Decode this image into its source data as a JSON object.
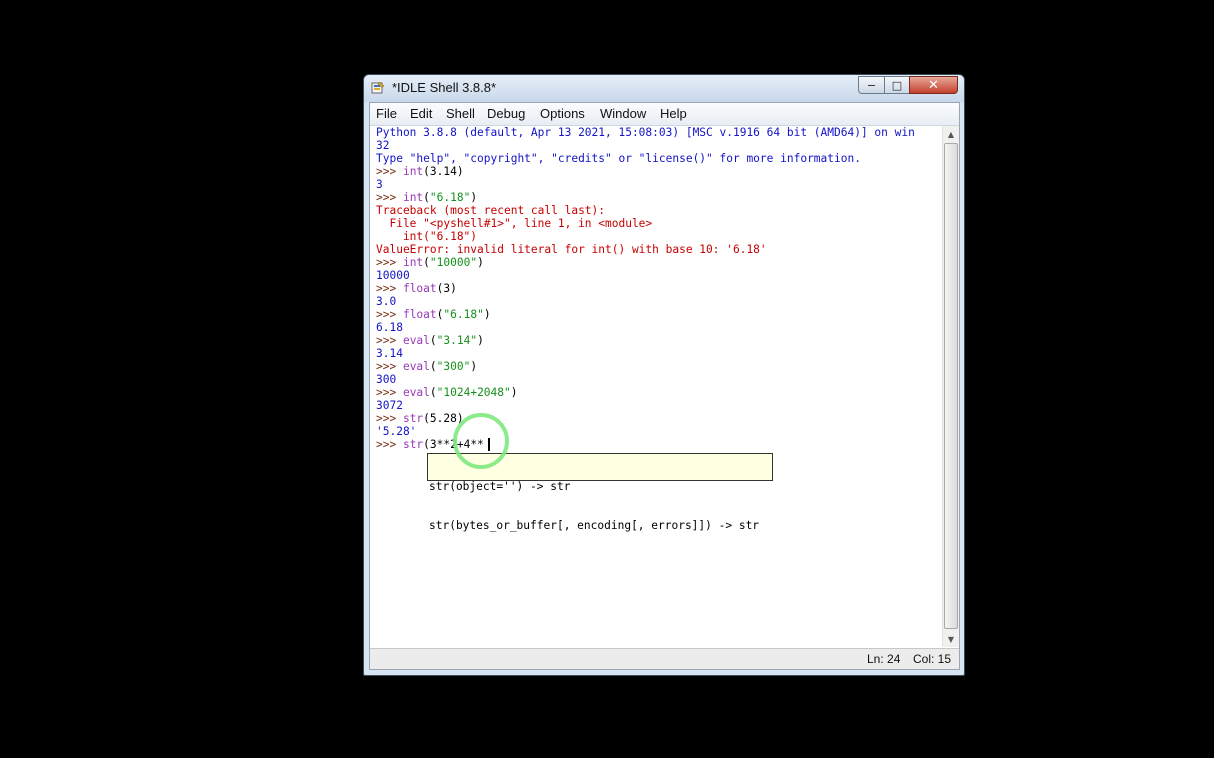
{
  "window": {
    "title": "*IDLE Shell 3.8.8*",
    "controls": {
      "minimize": "−",
      "maximize": "□",
      "close": "✕"
    }
  },
  "menu": [
    "File",
    "Edit",
    "Shell",
    "Debug",
    "Options",
    "Window",
    "Help"
  ],
  "colors": {
    "stdout": "#1313c8",
    "stderr": "#c80000",
    "keyword": "#9a38b8",
    "string": "#14901a",
    "prompt": "#7a2e16",
    "calltip_bg": "#ffffe1"
  },
  "shell_lines": [
    [
      {
        "t": "Python 3.8.8 (default, Apr 13 2021, 15:08:03) [MSC v.1916 64 bit (AMD64)] on win",
        "c": "stdout"
      }
    ],
    [
      {
        "t": "32",
        "c": "stdout"
      }
    ],
    [
      {
        "t": "Type \"help\", \"copyright\", \"credits\" or \"license()\" for more information.",
        "c": "stdout"
      }
    ],
    [
      {
        "t": ">>> ",
        "c": "prompt"
      },
      {
        "t": "int",
        "c": "keyword"
      },
      {
        "t": "(3.14)",
        "c": "plain"
      }
    ],
    [
      {
        "t": "3",
        "c": "stdout"
      }
    ],
    [
      {
        "t": ">>> ",
        "c": "prompt"
      },
      {
        "t": "int",
        "c": "keyword"
      },
      {
        "t": "(",
        "c": "plain"
      },
      {
        "t": "\"6.18\"",
        "c": "string"
      },
      {
        "t": ")",
        "c": "plain"
      }
    ],
    [
      {
        "t": "Traceback (most recent call last):",
        "c": "stderr"
      }
    ],
    [
      {
        "t": "  File \"<pyshell#1>\", line 1, in <module>",
        "c": "stderr"
      }
    ],
    [
      {
        "t": "    int(\"6.18\")",
        "c": "stderr"
      }
    ],
    [
      {
        "t": "ValueError: invalid literal for int() with base 10: '6.18'",
        "c": "stderr"
      }
    ],
    [
      {
        "t": ">>> ",
        "c": "prompt"
      },
      {
        "t": "int",
        "c": "keyword"
      },
      {
        "t": "(",
        "c": "plain"
      },
      {
        "t": "\"10000\"",
        "c": "string"
      },
      {
        "t": ")",
        "c": "plain"
      }
    ],
    [
      {
        "t": "10000",
        "c": "stdout"
      }
    ],
    [
      {
        "t": ">>> ",
        "c": "prompt"
      },
      {
        "t": "float",
        "c": "keyword"
      },
      {
        "t": "(3)",
        "c": "plain"
      }
    ],
    [
      {
        "t": "3.0",
        "c": "stdout"
      }
    ],
    [
      {
        "t": ">>> ",
        "c": "prompt"
      },
      {
        "t": "float",
        "c": "keyword"
      },
      {
        "t": "(",
        "c": "plain"
      },
      {
        "t": "\"6.18\"",
        "c": "string"
      },
      {
        "t": ")",
        "c": "plain"
      }
    ],
    [
      {
        "t": "6.18",
        "c": "stdout"
      }
    ],
    [
      {
        "t": ">>> ",
        "c": "prompt"
      },
      {
        "t": "eval",
        "c": "keyword"
      },
      {
        "t": "(",
        "c": "plain"
      },
      {
        "t": "\"3.14\"",
        "c": "string"
      },
      {
        "t": ")",
        "c": "plain"
      }
    ],
    [
      {
        "t": "3.14",
        "c": "stdout"
      }
    ],
    [
      {
        "t": ">>> ",
        "c": "prompt"
      },
      {
        "t": "eval",
        "c": "keyword"
      },
      {
        "t": "(",
        "c": "plain"
      },
      {
        "t": "\"300\"",
        "c": "string"
      },
      {
        "t": ")",
        "c": "plain"
      }
    ],
    [
      {
        "t": "300",
        "c": "stdout"
      }
    ],
    [
      {
        "t": ">>> ",
        "c": "prompt"
      },
      {
        "t": "eval",
        "c": "keyword"
      },
      {
        "t": "(",
        "c": "plain"
      },
      {
        "t": "\"1024+2048\"",
        "c": "string"
      },
      {
        "t": ")",
        "c": "plain"
      }
    ],
    [
      {
        "t": "3072",
        "c": "stdout"
      }
    ],
    [
      {
        "t": ">>> ",
        "c": "prompt"
      },
      {
        "t": "str",
        "c": "keyword"
      },
      {
        "t": "(5.28)",
        "c": "plain"
      }
    ],
    [
      {
        "t": "'5.28'",
        "c": "stdout"
      }
    ],
    [
      {
        "t": ">>> ",
        "c": "prompt"
      },
      {
        "t": "str",
        "c": "keyword"
      },
      {
        "t": "(3**2+4**",
        "c": "plain"
      }
    ]
  ],
  "calltip": {
    "line1": "str(object='') -> str",
    "line2": "str(bytes_or_buffer[, encoding[, errors]]) -> str"
  },
  "status": {
    "line": "Ln: 24",
    "col": "Col: 15"
  }
}
